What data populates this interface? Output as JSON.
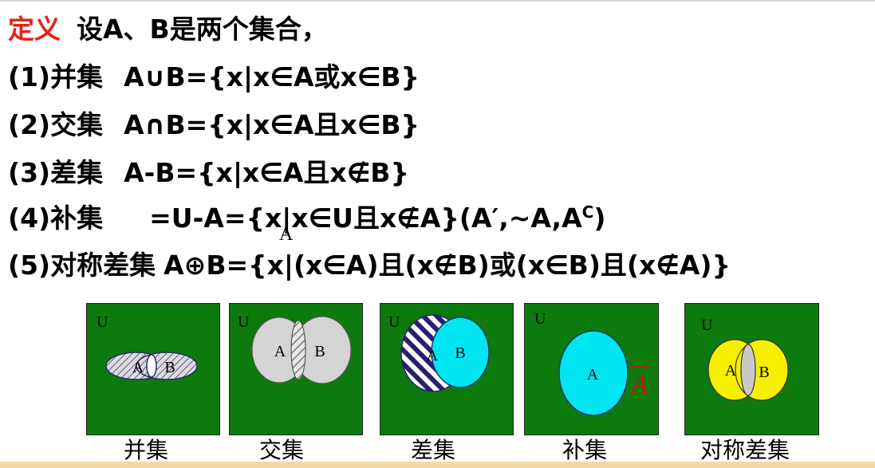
{
  "definition": {
    "keyword": "定义",
    "intro": "设A、B是两个集合，"
  },
  "items": [
    {
      "label": "(1)并集",
      "formula": "A∪B={x|x∈A或x∈B}"
    },
    {
      "label": "(2)交集",
      "formula": "A∩B={x|x∈A且x∈B}"
    },
    {
      "label": "(3)差集",
      "formula": "A-B={x|x∈A且x∉B}"
    },
    {
      "label": "(4)补集",
      "formula": "=U-A={x|x∈U且x∉A}(A′,~A,A",
      "formula_sup": "C",
      "formula_end": ")",
      "subscript": "A"
    },
    {
      "label": "(5)对称差集",
      "formula": "A⊕B={x|(x∈A)且(x∉B)或(x∈B)且(x∉A)}"
    }
  ],
  "diagrams": [
    {
      "caption": "并集",
      "universe": "U",
      "set_a": "A",
      "set_b": "B"
    },
    {
      "caption": "交集",
      "universe": "U",
      "set_a": "A",
      "set_b": "B"
    },
    {
      "caption": "差集",
      "universe": "U",
      "set_a": "A",
      "set_b": "B"
    },
    {
      "caption": "补集",
      "universe": "U",
      "set_a": "A",
      "complement": "A"
    },
    {
      "caption": "对称差集",
      "universe": "U",
      "set_a": "A",
      "set_b": "B"
    }
  ],
  "colors": {
    "keyword": "#e2231a",
    "universe": "#0c7a0c",
    "gray_set": "#d4d4d4",
    "cyan_set": "#00e5f0",
    "yellow_set": "#f7ef00",
    "hatch": "#2a1f6e",
    "complement_label": "#c0141a"
  }
}
